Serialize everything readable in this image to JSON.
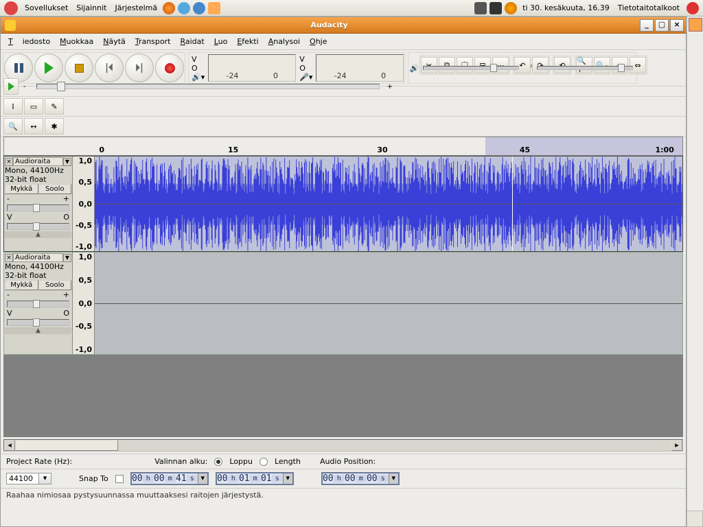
{
  "panel": {
    "apps": "Sovellukset",
    "places": "Sijainnit",
    "system": "Järjestelmä",
    "clock": "ti 30. kesäkuuta, 16.39",
    "user": "Tietotaitotalkoot"
  },
  "window": {
    "title": "Audacity"
  },
  "menu": {
    "file": "Tiedosto",
    "edit": "Muokkaa",
    "view": "Näytä",
    "transport": "Transport",
    "tracks": "Raidat",
    "create": "Luo",
    "effect": "Efekti",
    "analyze": "Analysoi",
    "help": "Ohje"
  },
  "meter": {
    "labelL": "V",
    "labelR": "O",
    "ticks": [
      "-24",
      "0"
    ]
  },
  "timeline": {
    "ticks": [
      {
        "pos": 14,
        "label": "0"
      },
      {
        "pos": 33,
        "label": "15"
      },
      {
        "pos": 55,
        "label": "30"
      },
      {
        "pos": 76,
        "label": "45"
      },
      {
        "pos": 96,
        "label": "1:00"
      }
    ],
    "selStart": 71,
    "selEnd": 100
  },
  "tracks": [
    {
      "name": "Audioraita",
      "info1": "Mono, 44100Hz",
      "info2": "32-bit float",
      "mute": "Mykkä",
      "solo": "Soolo",
      "vL": "-",
      "vR": "+",
      "pL": "V",
      "pR": "O",
      "height": 140,
      "has_wave": true
    },
    {
      "name": "Audioraita",
      "info1": "Mono, 44100Hz",
      "info2": "32-bit float",
      "mute": "Mykkä",
      "solo": "Soolo",
      "vL": "-",
      "vR": "+",
      "pL": "V",
      "pR": "O",
      "height": 150,
      "has_wave": false
    }
  ],
  "vscale": [
    "1,0",
    "0,5",
    "0,0",
    "-0,5",
    "-1,0"
  ],
  "bottom": {
    "project_rate_label": "Project Rate (Hz):",
    "rate": "44100",
    "snap_label": "Snap To",
    "sel_start_label": "Valinnan alku:",
    "end_label": "Loppu",
    "length_label": "Length",
    "audio_pos_label": "Audio Position:",
    "t1": {
      "h": "00",
      "m": "00",
      "s": "41"
    },
    "t2": {
      "h": "00",
      "m": "01",
      "s": "01"
    },
    "t3": {
      "h": "00",
      "m": "00",
      "s": "00"
    }
  },
  "status": "Raahaa nimiosaa pystysuunnassa muuttaaksesi raitojen järjestystä."
}
